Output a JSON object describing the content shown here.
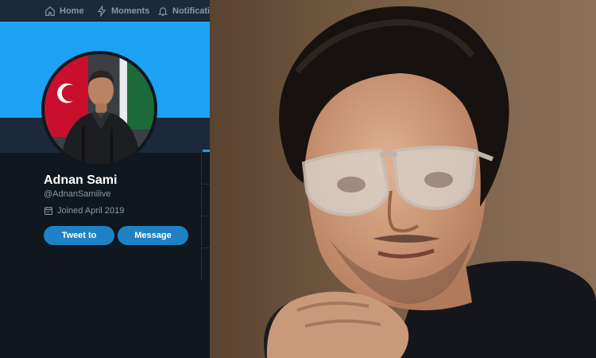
{
  "nav": {
    "items": [
      {
        "label": "Home",
        "icon": "home-icon"
      },
      {
        "label": "Moments",
        "icon": "lightning-icon"
      },
      {
        "label": "Notifications",
        "icon": "bell-icon"
      }
    ]
  },
  "profile": {
    "name": "Adnan Sami",
    "handle": "@AdnanSamilive",
    "joined": "Joined April 2019",
    "calendar_icon": "calendar-icon"
  },
  "actions": {
    "tweet_label": "Tweet to",
    "message_label": "Message"
  },
  "colors": {
    "banner": "#1da1f2",
    "background": "#10171e",
    "button": "#1d81c4",
    "nav_bar": "#1c2938"
  }
}
